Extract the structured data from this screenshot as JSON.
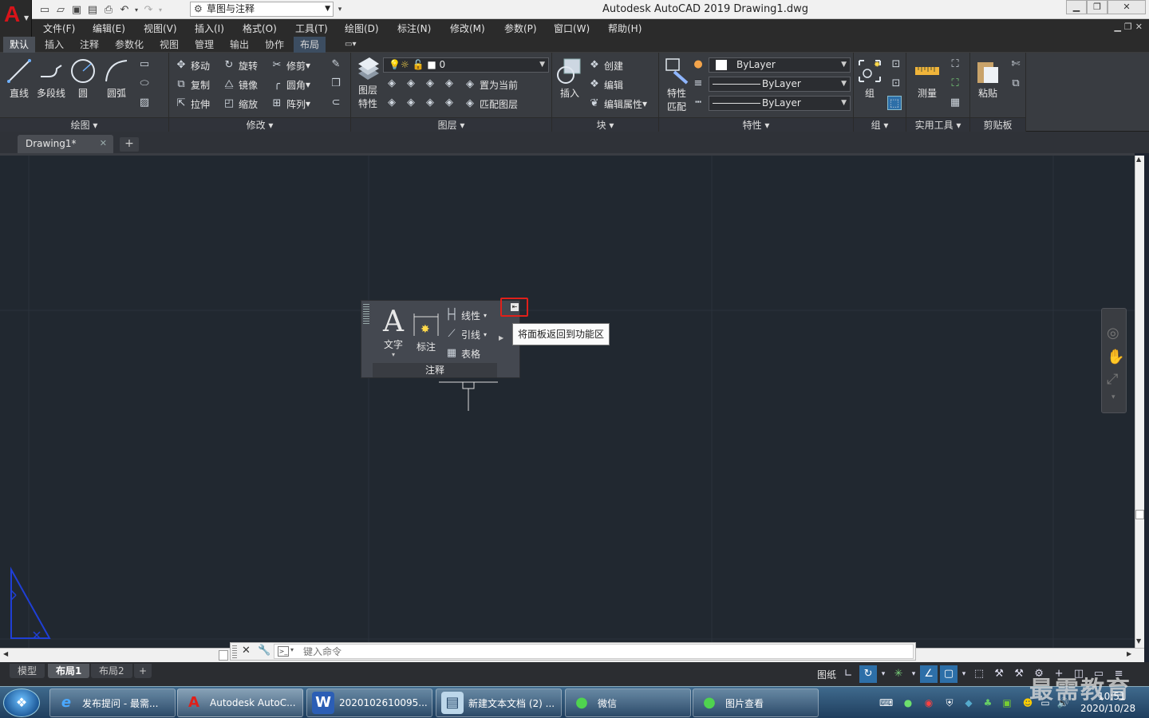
{
  "window": {
    "title": "Autodesk AutoCAD 2019    Drawing1.dwg",
    "workspace": "草图与注释"
  },
  "menu": [
    "文件(F)",
    "编辑(E)",
    "视图(V)",
    "插入(I)",
    "格式(O)",
    "工具(T)",
    "绘图(D)",
    "标注(N)",
    "修改(M)",
    "参数(P)",
    "窗口(W)",
    "帮助(H)"
  ],
  "ribbon_tabs": [
    "默认",
    "插入",
    "注释",
    "参数化",
    "视图",
    "管理",
    "输出",
    "协作",
    "布局"
  ],
  "active_ribbon_tab": "默认",
  "draw": {
    "line": "直线",
    "polyline": "多段线",
    "circle": "圆",
    "arc": "圆弧",
    "title": "绘图"
  },
  "modify": {
    "move": "移动",
    "rotate": "旋转",
    "trim": "修剪",
    "copy": "复制",
    "mirror": "镜像",
    "fillet": "圆角",
    "stretch": "拉伸",
    "scale": "缩放",
    "array": "阵列",
    "title": "修改"
  },
  "layer": {
    "props": "图层",
    "props2": "特性",
    "current_layer": "0",
    "set_current": "置为当前",
    "match": "匹配图层",
    "title": "图层"
  },
  "block": {
    "insert": "插入",
    "create": "创建",
    "edit": "编辑",
    "edit_attr": "编辑属性",
    "title": "块"
  },
  "properties": {
    "match1": "特性",
    "match2": "匹配",
    "color": "ByLayer",
    "linetype": "ByLayer",
    "lineweight": "ByLayer",
    "title": "特性"
  },
  "group": {
    "btn": "组",
    "title": "组"
  },
  "utilities": {
    "measure": "测量",
    "title": "实用工具"
  },
  "clipboard": {
    "paste": "粘贴",
    "title": "剪贴板"
  },
  "doc_tab": "Drawing1*",
  "floating_panel": {
    "text": "文字",
    "dim": "标注",
    "linear": "线性",
    "leader": "引线",
    "table": "表格",
    "title": "注释"
  },
  "tooltip": "将面板返回到功能区",
  "command": {
    "placeholder": "键入命令"
  },
  "layout_tabs": [
    "模型",
    "布局1",
    "布局2"
  ],
  "active_layout": "布局1",
  "status": {
    "paper": "图纸"
  },
  "taskbar": [
    {
      "label": "发布提问 - 最需...",
      "icon": "ie-icon"
    },
    {
      "label": "Autodesk AutoC...",
      "icon": "autocad-icon"
    },
    {
      "label": "2020102610095...",
      "icon": "word-icon"
    },
    {
      "label": "新建文本文档 (2) ...",
      "icon": "notepad-icon"
    },
    {
      "label": "微信",
      "icon": "wechat-icon"
    },
    {
      "label": "图片查看",
      "icon": "wechat-icon"
    }
  ],
  "clock": {
    "time": "10:51",
    "date": "2020/10/28"
  },
  "watermark": "最需教育",
  "colors": {
    "canvas": "#212830",
    "ribbon": "#393c41",
    "highlight": "#e0201a",
    "accent_blue": "#2d6fa8"
  }
}
